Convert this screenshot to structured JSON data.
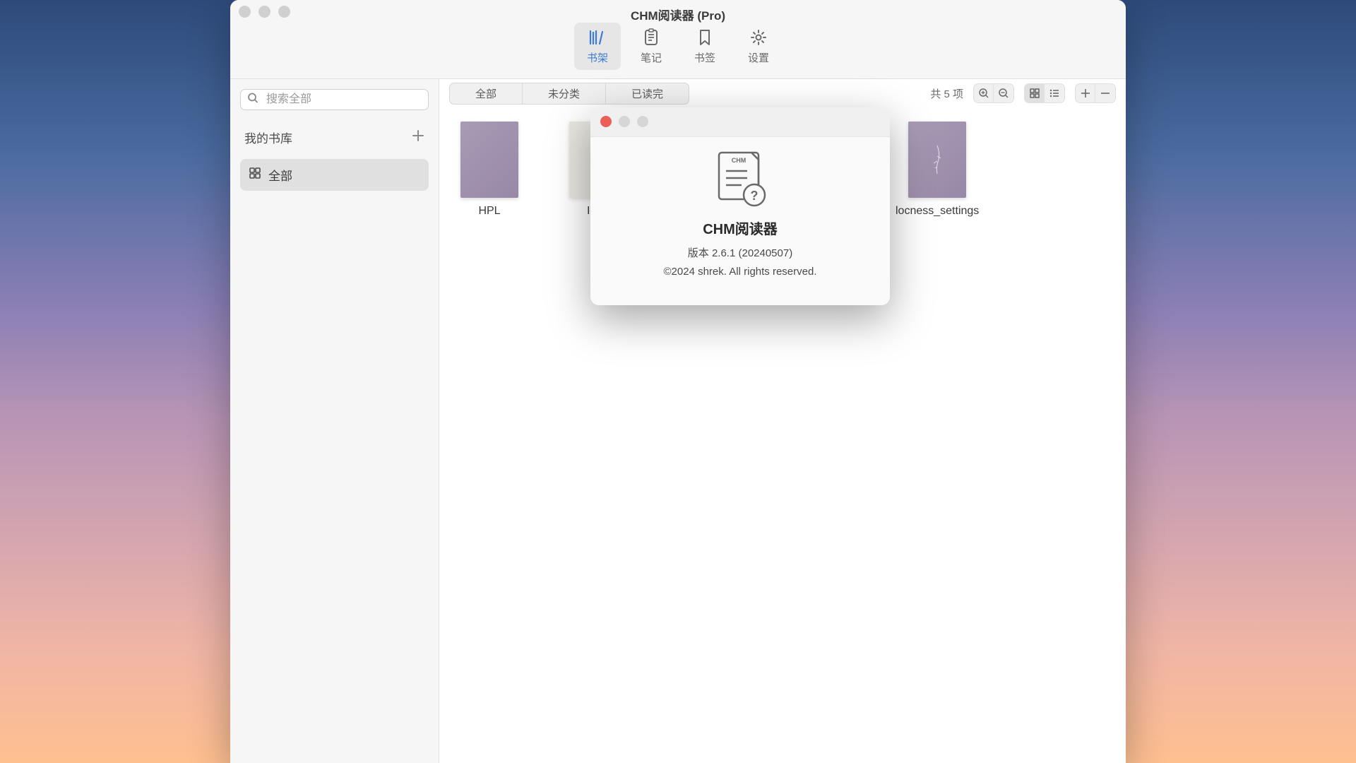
{
  "window": {
    "title": "CHM阅读器 (Pro)"
  },
  "mainTabs": [
    {
      "label": "书架",
      "icon": "library"
    },
    {
      "label": "笔记",
      "icon": "notes"
    },
    {
      "label": "书签",
      "icon": "bookmark"
    },
    {
      "label": "设置",
      "icon": "settings"
    }
  ],
  "sidebar": {
    "search": {
      "placeholder": "搜索全部"
    },
    "libraryTitle": "我的书库",
    "items": [
      {
        "label": "全部",
        "selected": true
      }
    ]
  },
  "content": {
    "filterTabs": [
      "全部",
      "未分类",
      "已读完"
    ],
    "itemCount": "共 5 项",
    "books": [
      {
        "name": "HPL"
      },
      {
        "name": "Inter"
      },
      {
        "name": ""
      },
      {
        "name": ""
      },
      {
        "name": "locness_settings"
      }
    ]
  },
  "about": {
    "appName": "CHM阅读器",
    "iconText": "CHM",
    "version": "版本 2.6.1 (20240507)",
    "copyright": "©2024 shrek. All rights reserved."
  }
}
